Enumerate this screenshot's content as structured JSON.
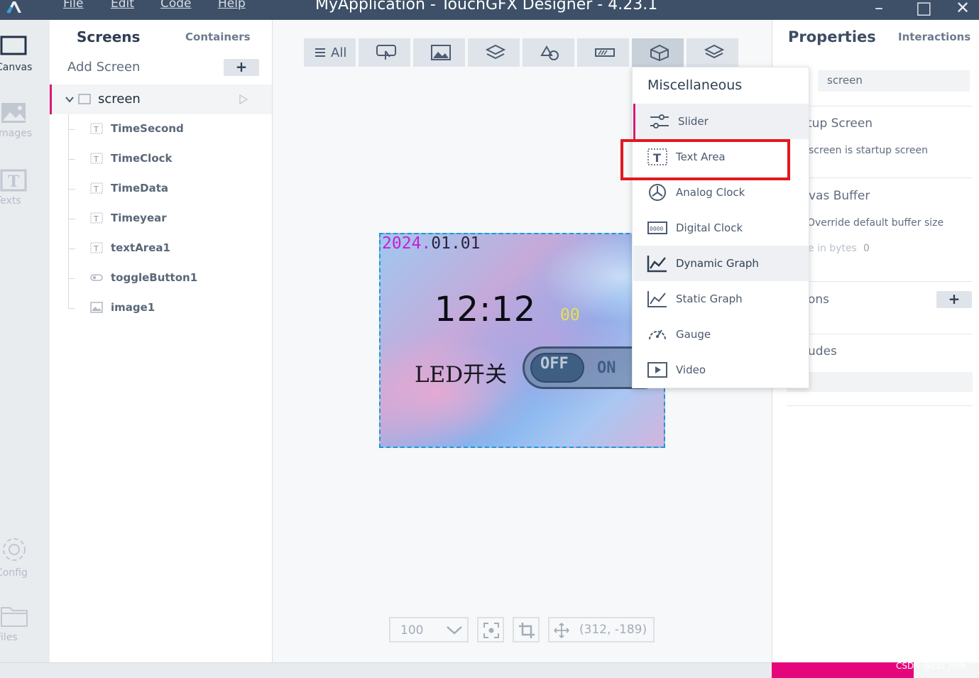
{
  "app_title": "MyApplication - TouchGFX Designer - 4.23.1",
  "menu": [
    "File",
    "Edit",
    "Code",
    "Help"
  ],
  "window_buttons": {
    "minimize": "–",
    "maximize": "□",
    "close": "✕"
  },
  "left_rail": {
    "canvas": "Canvas",
    "images": "Images",
    "texts": "Texts",
    "config": "Config",
    "files": "Files"
  },
  "screens_panel": {
    "tab_screens": "Screens",
    "tab_containers": "Containers",
    "add_screen": "Add Screen",
    "add_symbol": "+",
    "screen_name": "screen",
    "widgets": [
      {
        "name": "TimeSecond",
        "icon": "text-area-icon"
      },
      {
        "name": "TimeClock",
        "icon": "text-area-icon"
      },
      {
        "name": "TimeData",
        "icon": "text-area-icon"
      },
      {
        "name": "Timeyear",
        "icon": "text-area-icon"
      },
      {
        "name": "textArea1",
        "icon": "text-area-icon"
      },
      {
        "name": "toggleButton1",
        "icon": "toggle-icon"
      },
      {
        "name": "image1",
        "icon": "image-icon"
      }
    ]
  },
  "toolbar": {
    "all_label": "All",
    "buttons": [
      "all-icon",
      "touch-icon",
      "image-icon",
      "containers-icon",
      "shapes-icon",
      "progress-icon",
      "misc-icon",
      "layers-icon"
    ]
  },
  "device": {
    "date_year": "2024.",
    "date_rest": "01.01",
    "time": "12:12",
    "seconds": "00",
    "led_label": "LED开关",
    "toggle_off": "OFF",
    "toggle_on": "ON"
  },
  "bottom_bar": {
    "zoom": "100",
    "coords": "(312, -189)"
  },
  "dropdown": {
    "title": "Miscellaneous",
    "items": [
      {
        "label": "Slider",
        "icon": "slider-icon"
      },
      {
        "label": "Text Area",
        "icon": "text-area-icon"
      },
      {
        "label": "Analog Clock",
        "icon": "analog-clock-icon"
      },
      {
        "label": "Digital Clock",
        "icon": "digital-clock-icon"
      },
      {
        "label": "Dynamic Graph",
        "icon": "dynamic-graph-icon"
      },
      {
        "label": "Static Graph",
        "icon": "static-graph-icon"
      },
      {
        "label": "Gauge",
        "icon": "gauge-icon"
      },
      {
        "label": "Video",
        "icon": "video-icon"
      }
    ]
  },
  "properties": {
    "tab_properties": "Properties",
    "tab_interactions": "Interactions",
    "name_value": "screen",
    "startup_heading": "tup Screen",
    "startup_desc": "screen is startup screen",
    "buffer_heading": "vas Buffer",
    "buffer_desc": "Override default buffer size",
    "buffer_size_label": "e in bytes",
    "buffer_size_value": "0",
    "actions_heading": "ons",
    "actions_add": "+",
    "includes_heading": "udes"
  },
  "watermark": "CSDN @cat_milk",
  "colors": {
    "titlebar": "#3e5068",
    "accent": "#d81b72",
    "highlight_box": "#e2181f",
    "device_border": "#1a9ad6"
  }
}
